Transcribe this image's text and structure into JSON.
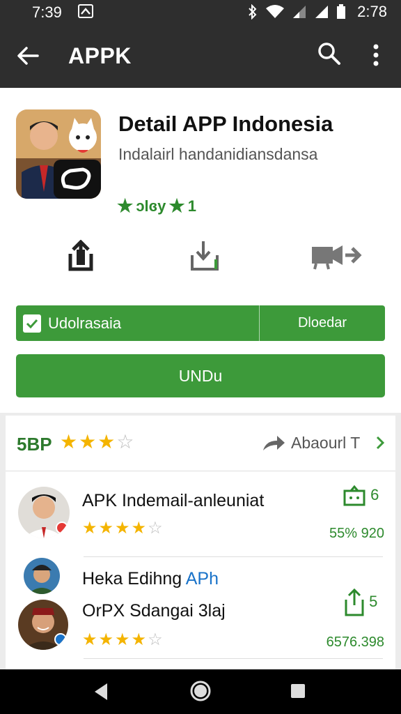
{
  "status_bar": {
    "time_left": "7:39",
    "time_right": "2:78"
  },
  "app_bar": {
    "title": "APPK"
  },
  "app": {
    "name": "Detail APP Indonesia",
    "developer": "Indalairl handanidiansdansa",
    "rating_text": "ɔlɞy",
    "rating_suffix": "1",
    "rating_color": "#2d8a2d"
  },
  "buttons": {
    "wishlist_label": "Udolrasaia",
    "download_label": "Dloedar",
    "install_label": "UNDu",
    "accent": "#3d9a3a"
  },
  "reviews": {
    "score": "5BP",
    "score_stars": 3,
    "about_label": "Abaourl T",
    "items": [
      {
        "name": "APK Indemail-anleuniat",
        "stars": 4,
        "count": "6",
        "meta": "55% 920"
      },
      {
        "name_a": "Heka Edihng",
        "name_a_blue": "APh",
        "name_b": "OrPX Sdangai 3laj",
        "stars": 4,
        "count": "5",
        "meta": "6576.398"
      }
    ]
  },
  "icons": [
    "back-arrow-icon",
    "search-icon",
    "more-vert-icon",
    "share-icon",
    "download-icon",
    "video-icon",
    "check-icon",
    "chevron-right-icon",
    "back-nav-icon",
    "home-nav-icon",
    "recents-nav-icon"
  ]
}
